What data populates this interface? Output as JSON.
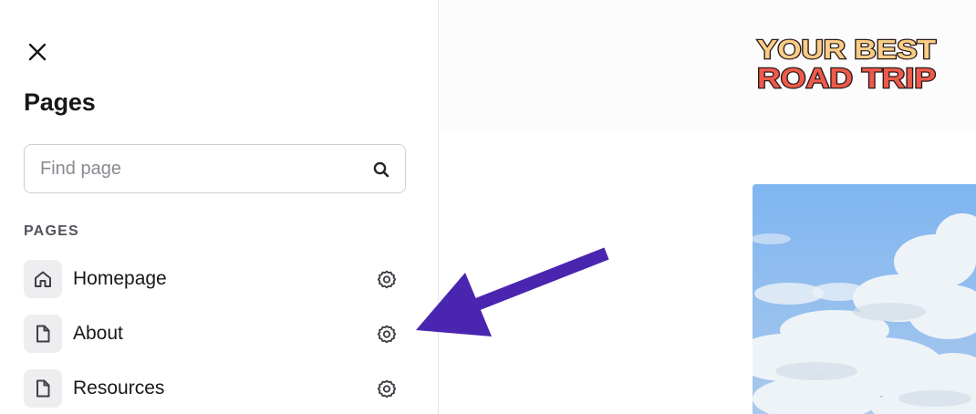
{
  "panel": {
    "title": "Pages",
    "search": {
      "placeholder": "Find page",
      "value": ""
    },
    "section_label": "PAGES",
    "items": [
      {
        "label": "Homepage",
        "icon": "home-icon"
      },
      {
        "label": "About",
        "icon": "document-icon"
      },
      {
        "label": "Resources",
        "icon": "document-icon"
      }
    ]
  },
  "preview": {
    "logo": {
      "line1": "YOUR BEST",
      "line2": "ROAD TRIP"
    }
  },
  "annotation": {
    "arrow_color": "#4a25b0",
    "points_to": "About settings"
  },
  "colors": {
    "logo_top": "#f9cd86",
    "logo_bottom": "#ee5a4a",
    "logo_outline": "#2b1a1a",
    "panel_border": "#e4e4e7",
    "text_primary": "#18181b"
  }
}
